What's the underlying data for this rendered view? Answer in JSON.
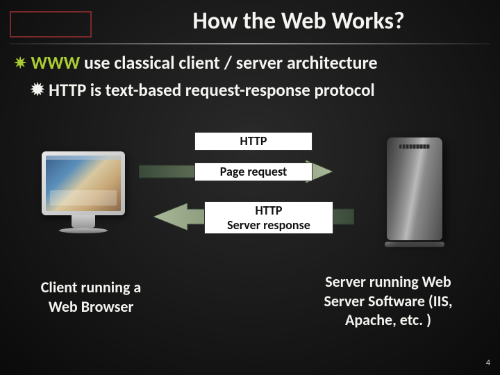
{
  "slide": {
    "title": "How the Web Works?",
    "page_number": "4"
  },
  "bullets": {
    "b1_www": "WWW",
    "b1_rest": " use classical client / server architecture",
    "b2": "HTTP is text-based request-response protocol"
  },
  "diagram": {
    "label_http": "HTTP",
    "label_request": "Page request",
    "label_response": "HTTP\nServer response",
    "caption_client": "Client running a Web Browser",
    "caption_server": "Server running Web Server Software (IIS, Apache, etc. )"
  }
}
